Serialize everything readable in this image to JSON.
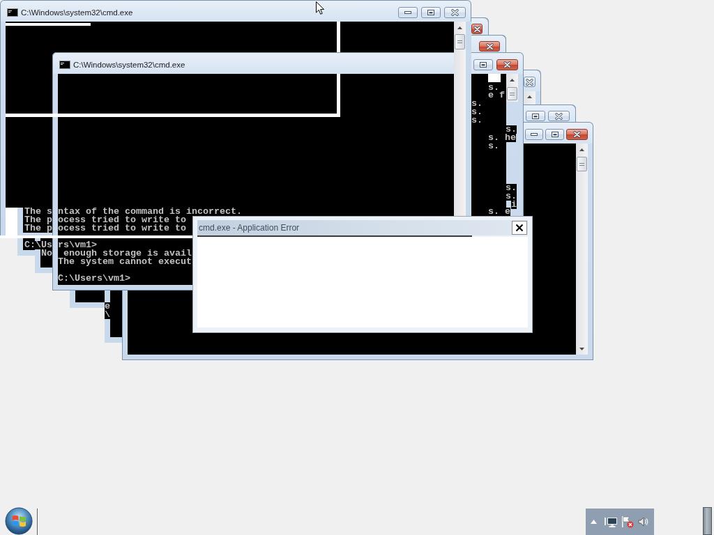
{
  "windows": [
    {
      "kind": "full",
      "title": "C:\\Windows\\system32\\cmd.exe",
      "close_highlighted": false
    },
    {
      "kind": "edge",
      "close_highlighted": true
    },
    {
      "kind": "edge",
      "close_highlighted": true
    },
    {
      "kind": "full",
      "title": "C:\\Windows\\system32\\cmd.exe",
      "close_highlighted": true,
      "console_lines": [
        "ntax of the command is incorrect.",
        "ocess tried to write to",
        "ocess tried to write to",
        "rs\\vm1>",
        " enough storage is avail",
        "The system cannot execut",
        "C:\\Users\\vm1>"
      ]
    },
    {
      "kind": "edge",
      "close_highlighted": false
    },
    {
      "kind": "edge",
      "close_highlighted": false
    },
    {
      "kind": "full",
      "close_highlighted": true
    }
  ],
  "stale_text": [
    "The s",
    "The p",
    "The p",
    "C:\\Us",
    "No",
    "s.",
    "e f",
    "s.",
    "s.",
    "s.",
    "s.",
    "s. he",
    "s.",
    "s.",
    "s.",
    "i",
    "s. e",
    "e",
    "\\"
  ],
  "error_dialog": {
    "title": "cmd.exe - Application Error"
  },
  "taskbar": {
    "tray_icons": [
      {
        "kind": "caret"
      },
      {
        "kind": "monitor"
      },
      {
        "kind": "flag"
      },
      {
        "kind": "speaker"
      }
    ]
  }
}
